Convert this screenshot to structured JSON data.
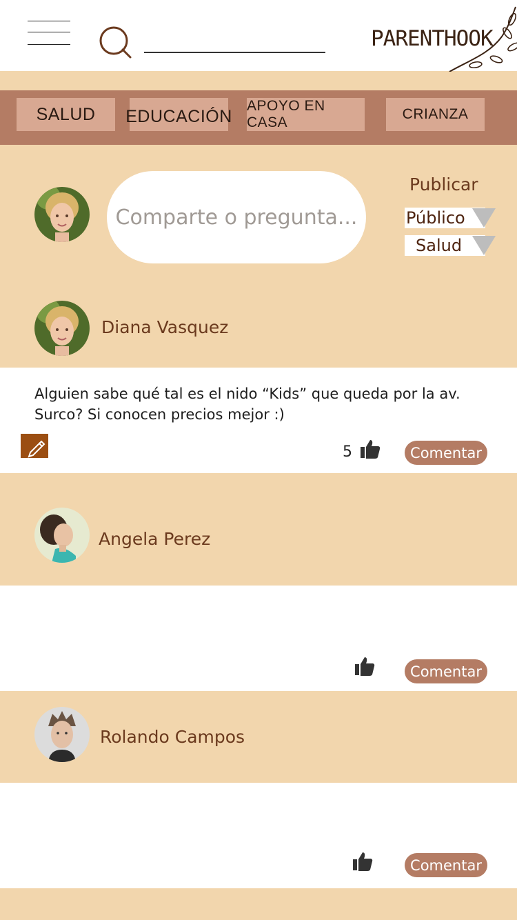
{
  "header": {
    "logo_text": "PARENTHOOK",
    "search_placeholder": ""
  },
  "categories": [
    "SALUD",
    "EDUCACIÓN",
    "APOYO EN CASA",
    "CRIANZA"
  ],
  "composer": {
    "placeholder": "Comparte o pregunta...",
    "publish_label": "Publicar",
    "visibility": "Público",
    "topic": "Salud"
  },
  "posts": [
    {
      "author": "Diana Vasquez",
      "body": "Alguien sabe qué tal es el nido “Kids” que queda por la av. Surco? Si conocen precios mejor :)",
      "likes": "5",
      "comment_label": "Comentar"
    },
    {
      "author": "Angela Perez",
      "body": "",
      "likes": "",
      "comment_label": "Comentar"
    },
    {
      "author": "Rolando Campos",
      "body": "",
      "likes": "",
      "comment_label": "Comentar"
    }
  ],
  "colors": {
    "background": "#f2d6ad",
    "category_bar": "#b47c64",
    "category_button": "#d8a892",
    "accent_brown": "#6b3a1e",
    "comment_button": "#b47c64",
    "edit_icon": "#9b4e12"
  },
  "icons": [
    "menu-icon",
    "search-icon",
    "like-icon",
    "edit-icon",
    "dropdown-arrow-icon"
  ]
}
